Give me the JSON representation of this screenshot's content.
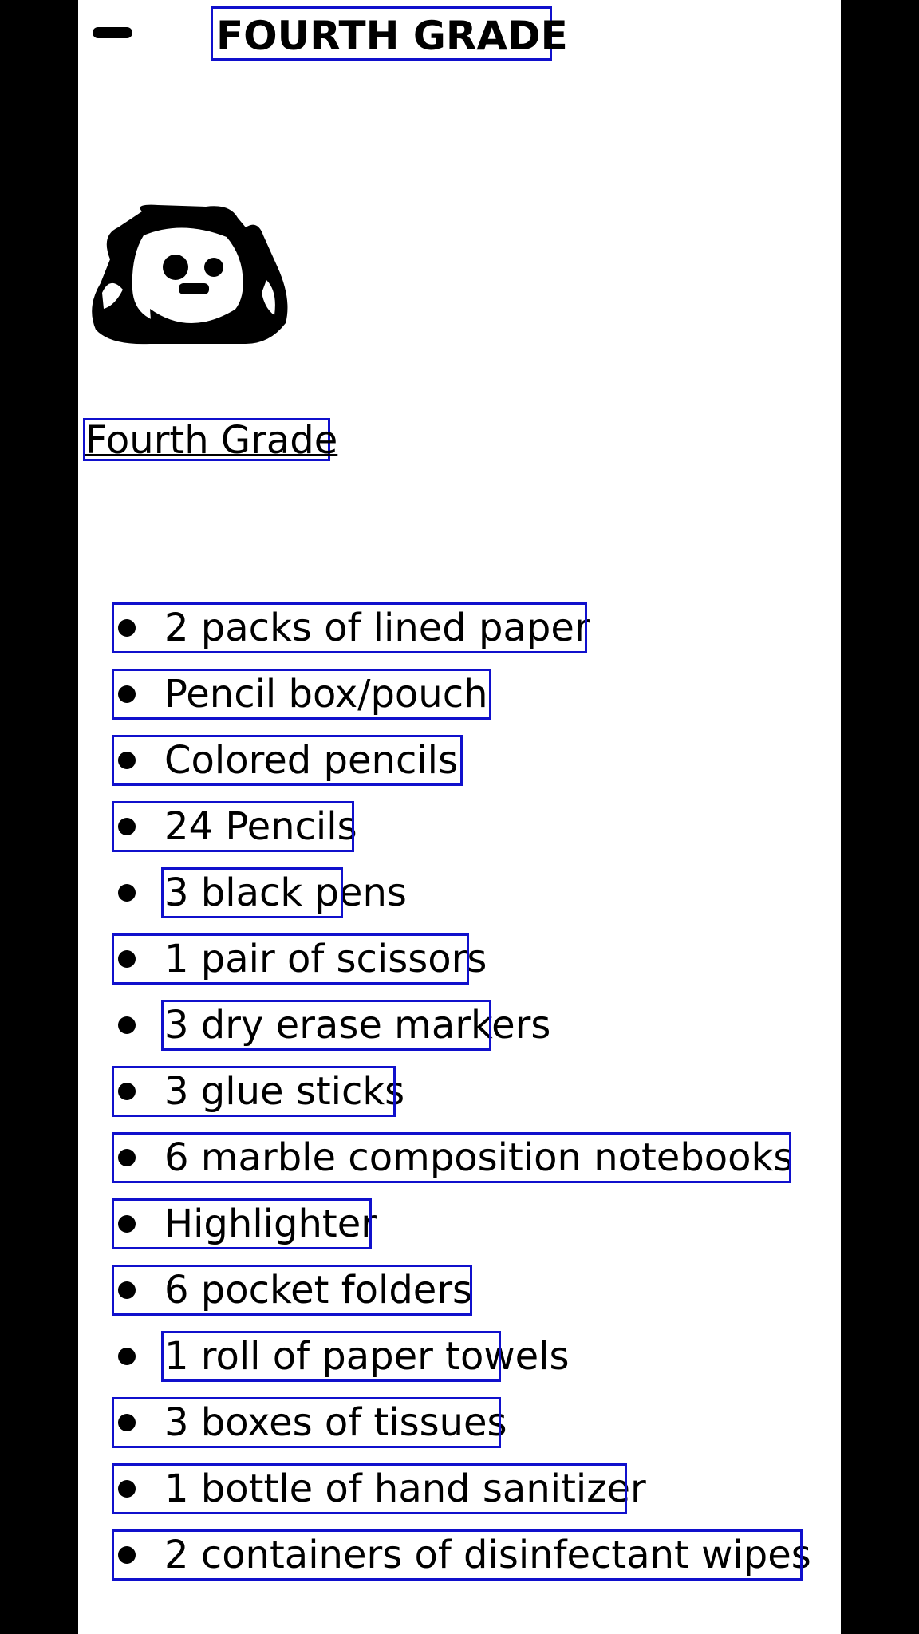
{
  "header": {
    "title": "FOURTH GRADE",
    "menu_icon": "hamburger-menu-icon"
  },
  "mascot": {
    "icon": "backpack-icon"
  },
  "section": {
    "heading": "Fourth Grade"
  },
  "supplies": [
    "2 packs of lined paper",
    "Pencil box/pouch",
    "Colored pencils",
    "24 Pencils",
    "3 black pens",
    "1 pair of scissors",
    "3 dry erase markers",
    "3 glue sticks",
    "6 marble composition notebooks",
    "Highlighter",
    "6 pocket folders",
    "1 roll of paper towels",
    "3 boxes of tissues",
    "1 bottle of hand sanitizer",
    "2 containers of disinfectant wipes"
  ],
  "colors": {
    "background": "#000000",
    "page": "#ffffff",
    "annotation_box": "#1010cc",
    "annotation_separator": "#e01010"
  }
}
